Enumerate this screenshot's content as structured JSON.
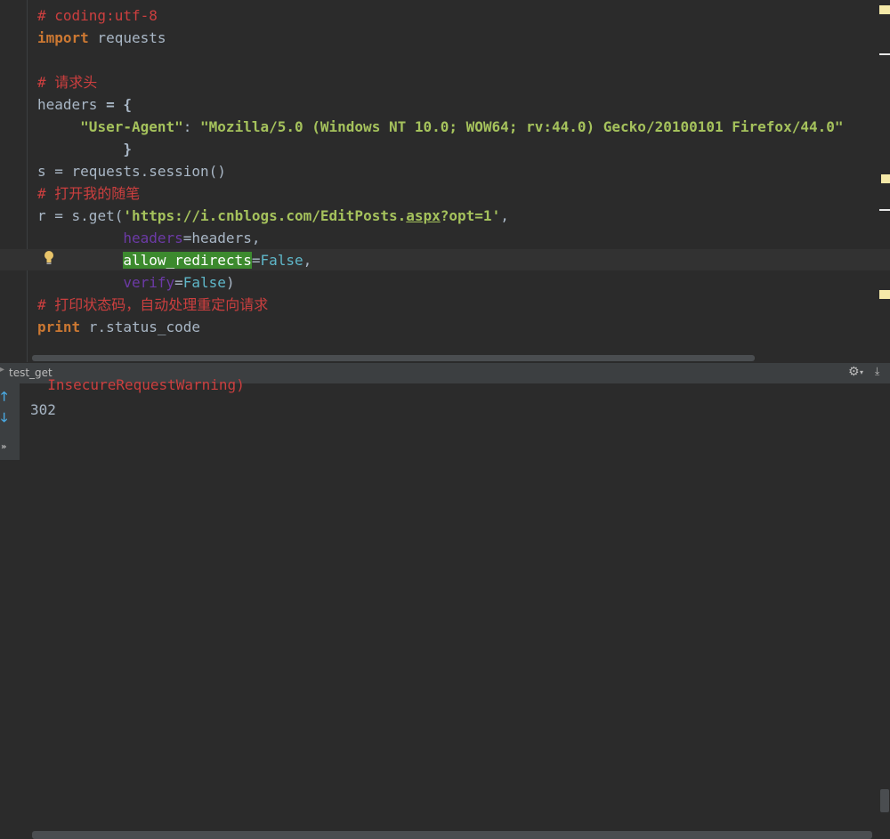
{
  "editor": {
    "lines": {
      "l1": "# coding:utf-8",
      "l2_kw": "import",
      "l2_mod": " requests",
      "l4": "# 请求头",
      "l5_id": "headers",
      "l5_op": " = {",
      "l6_indent": "     ",
      "l6_key": "\"User-Agent\"",
      "l6_colon": ": ",
      "l6_val": "\"Mozilla/5.0 (Windows NT 10.0; WOW64; rv:44.0) Gecko/20100101 Firefox/44.0\"",
      "l7": "          }",
      "l8_a": "s",
      "l8_b": " = requests.session()",
      "l9": "# 打开我的随笔",
      "l10_a": "r",
      "l10_b": " = s.get(",
      "l10_str1": "'https://i.cnblogs.com/EditPosts.",
      "l10_str2": "aspx",
      "l10_str3": "?opt=1'",
      "l10_end": ",",
      "l11_indent": "          ",
      "l11_param": "headers",
      "l11_rest": "=headers,",
      "l12_indent": "          ",
      "l12_param": "allow_redirects",
      "l12_eq": "=",
      "l12_val": "False",
      "l12_end": ",",
      "l13_indent": "          ",
      "l13_param": "verify",
      "l13_eq": "=",
      "l13_val": "False",
      "l13_end": ")",
      "l14": "# 打印状态码，自动处理重定向请求",
      "l15_kw": "print",
      "l15_rest": " r.status_code"
    }
  },
  "run_panel": {
    "title": "test_get",
    "settings_icon": "gear-icon",
    "console_lines": {
      "warning": "  InsecureRequestWarning)",
      "output": "302"
    }
  },
  "colors": {
    "background": "#2b2b2b",
    "comment": "#cc3f3f",
    "keyword": "#cc7832",
    "string": "#a5c25c",
    "selection": "#3c8a2e"
  }
}
